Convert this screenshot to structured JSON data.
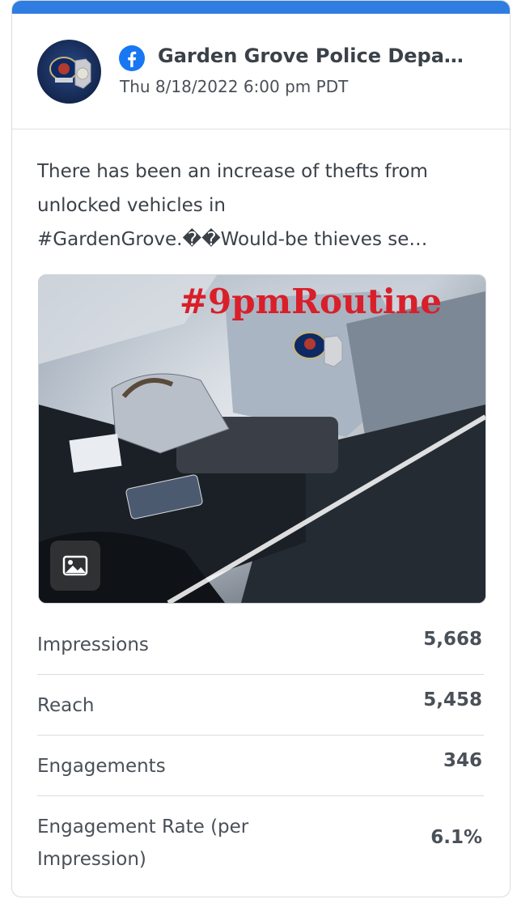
{
  "post": {
    "page_name": "Garden Grove Police Depa…",
    "timestamp": "Thu 8/18/2022 6:00 pm PDT",
    "network_icon": "facebook-icon",
    "text_lines": [
      "There has been an increase of thefts from",
      "unlocked vehicles in",
      "#GardenGrove.��Would-be thieves se…"
    ],
    "image_caption": "#9pmRoutine",
    "image_badge_icon": "image-icon"
  },
  "stats": [
    {
      "label": "Impressions",
      "value": "5,668"
    },
    {
      "label": "Reach",
      "value": "5,458"
    },
    {
      "label": "Engagements",
      "value": "346"
    },
    {
      "label": "Engagement Rate (per Impression)",
      "value": "6.1%"
    }
  ],
  "colors": {
    "accent": "#2f7de1",
    "facebook": "#1877f2",
    "caption_red": "#d91f2a",
    "text": "#3b4148"
  }
}
